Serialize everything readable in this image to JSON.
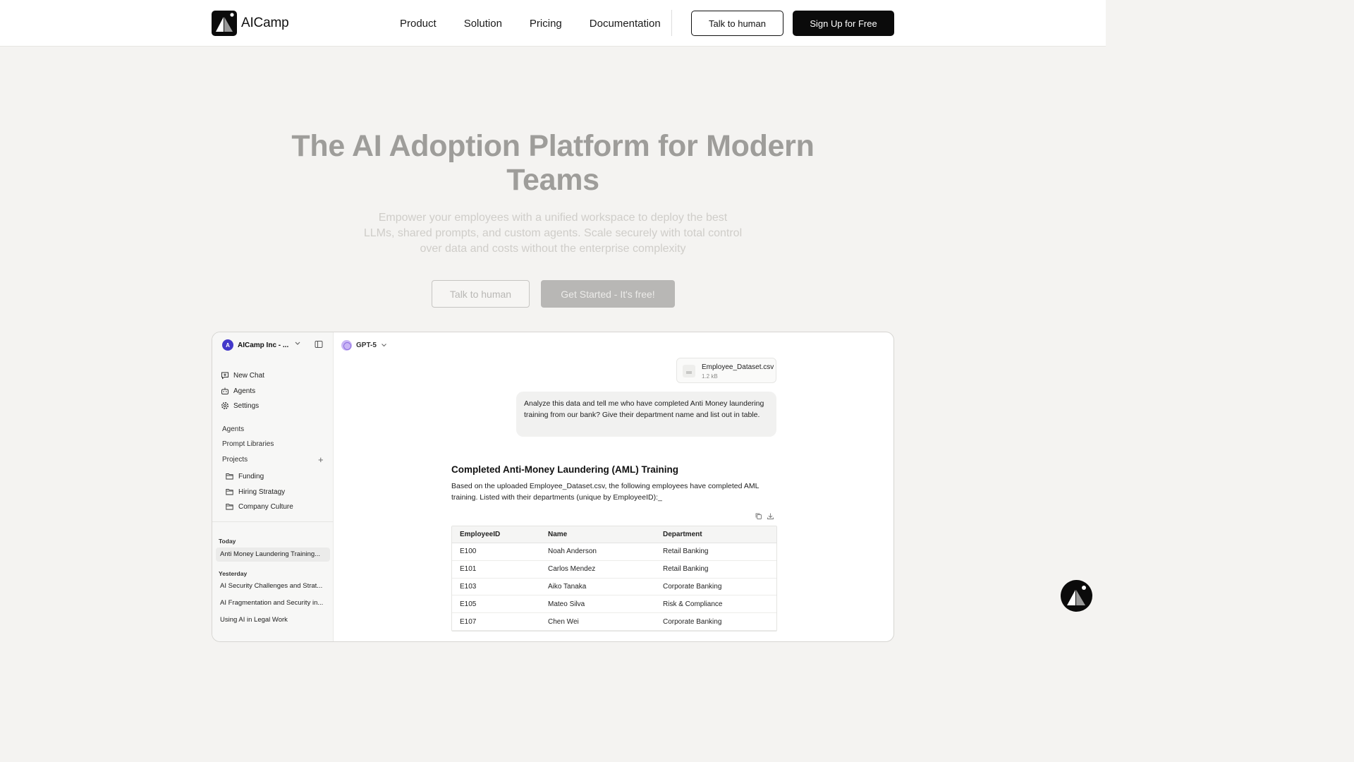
{
  "header": {
    "brand_name": "AICamp",
    "nav": [
      "Product",
      "Solution",
      "Pricing",
      "Documentation"
    ],
    "talk_label": "Talk to human",
    "signup_label": "Sign Up for Free"
  },
  "hero": {
    "title": "The AI Adoption Platform for Modern Teams",
    "subtitle": "Empower your employees with a unified workspace to deploy the best LLMs, shared prompts, and custom agents. Scale securely with total control over data and costs without the enterprise complexity",
    "talk_label": "Talk to human",
    "cta_label": "Get Started - It's free!"
  },
  "app": {
    "workspace": {
      "avatar": "A",
      "name": "AICamp Inc - ..."
    },
    "primary_nav": [
      {
        "label": "New Chat",
        "icon": "chat-plus-icon"
      },
      {
        "label": "Agents",
        "icon": "robot-icon"
      },
      {
        "label": "Settings",
        "icon": "gear-icon"
      }
    ],
    "secondary_nav": {
      "agents": "Agents",
      "prompt_libraries": "Prompt Libraries",
      "projects": "Projects"
    },
    "projects": [
      "Funding",
      "Hiring Stratagy",
      "Company Culture"
    ],
    "history": {
      "today_label": "Today",
      "today": [
        "Anti Money Laundering Training..."
      ],
      "yesterday_label": "Yesterday",
      "yesterday": [
        "AI Security Challenges and Strat...",
        "AI Fragmentation and Security in...",
        "Using AI in Legal Work"
      ]
    },
    "model": "GPT-5",
    "file": {
      "name": "Employee_Dataset.csv",
      "size": "1.2 kB"
    },
    "user_message": "Analyze this data and tell me who have completed Anti Money laundering training from our bank? Give their department name and list out in table.",
    "answer": {
      "title": "Completed Anti-Money Laundering (AML) Training",
      "body": "Based on the uploaded Employee_Dataset.csv, the following employees have completed AML training. Listed with their departments (unique by EmployeeID):_",
      "columns": [
        "EmployeeID",
        "Name",
        "Department"
      ],
      "rows": [
        [
          "E100",
          "Noah Anderson",
          "Retail Banking"
        ],
        [
          "E101",
          "Carlos Mendez",
          "Retail Banking"
        ],
        [
          "E103",
          "Aiko Tanaka",
          "Corporate Banking"
        ],
        [
          "E105",
          "Mateo Silva",
          "Risk & Compliance"
        ],
        [
          "E107",
          "Chen Wei",
          "Corporate Banking"
        ]
      ]
    }
  }
}
